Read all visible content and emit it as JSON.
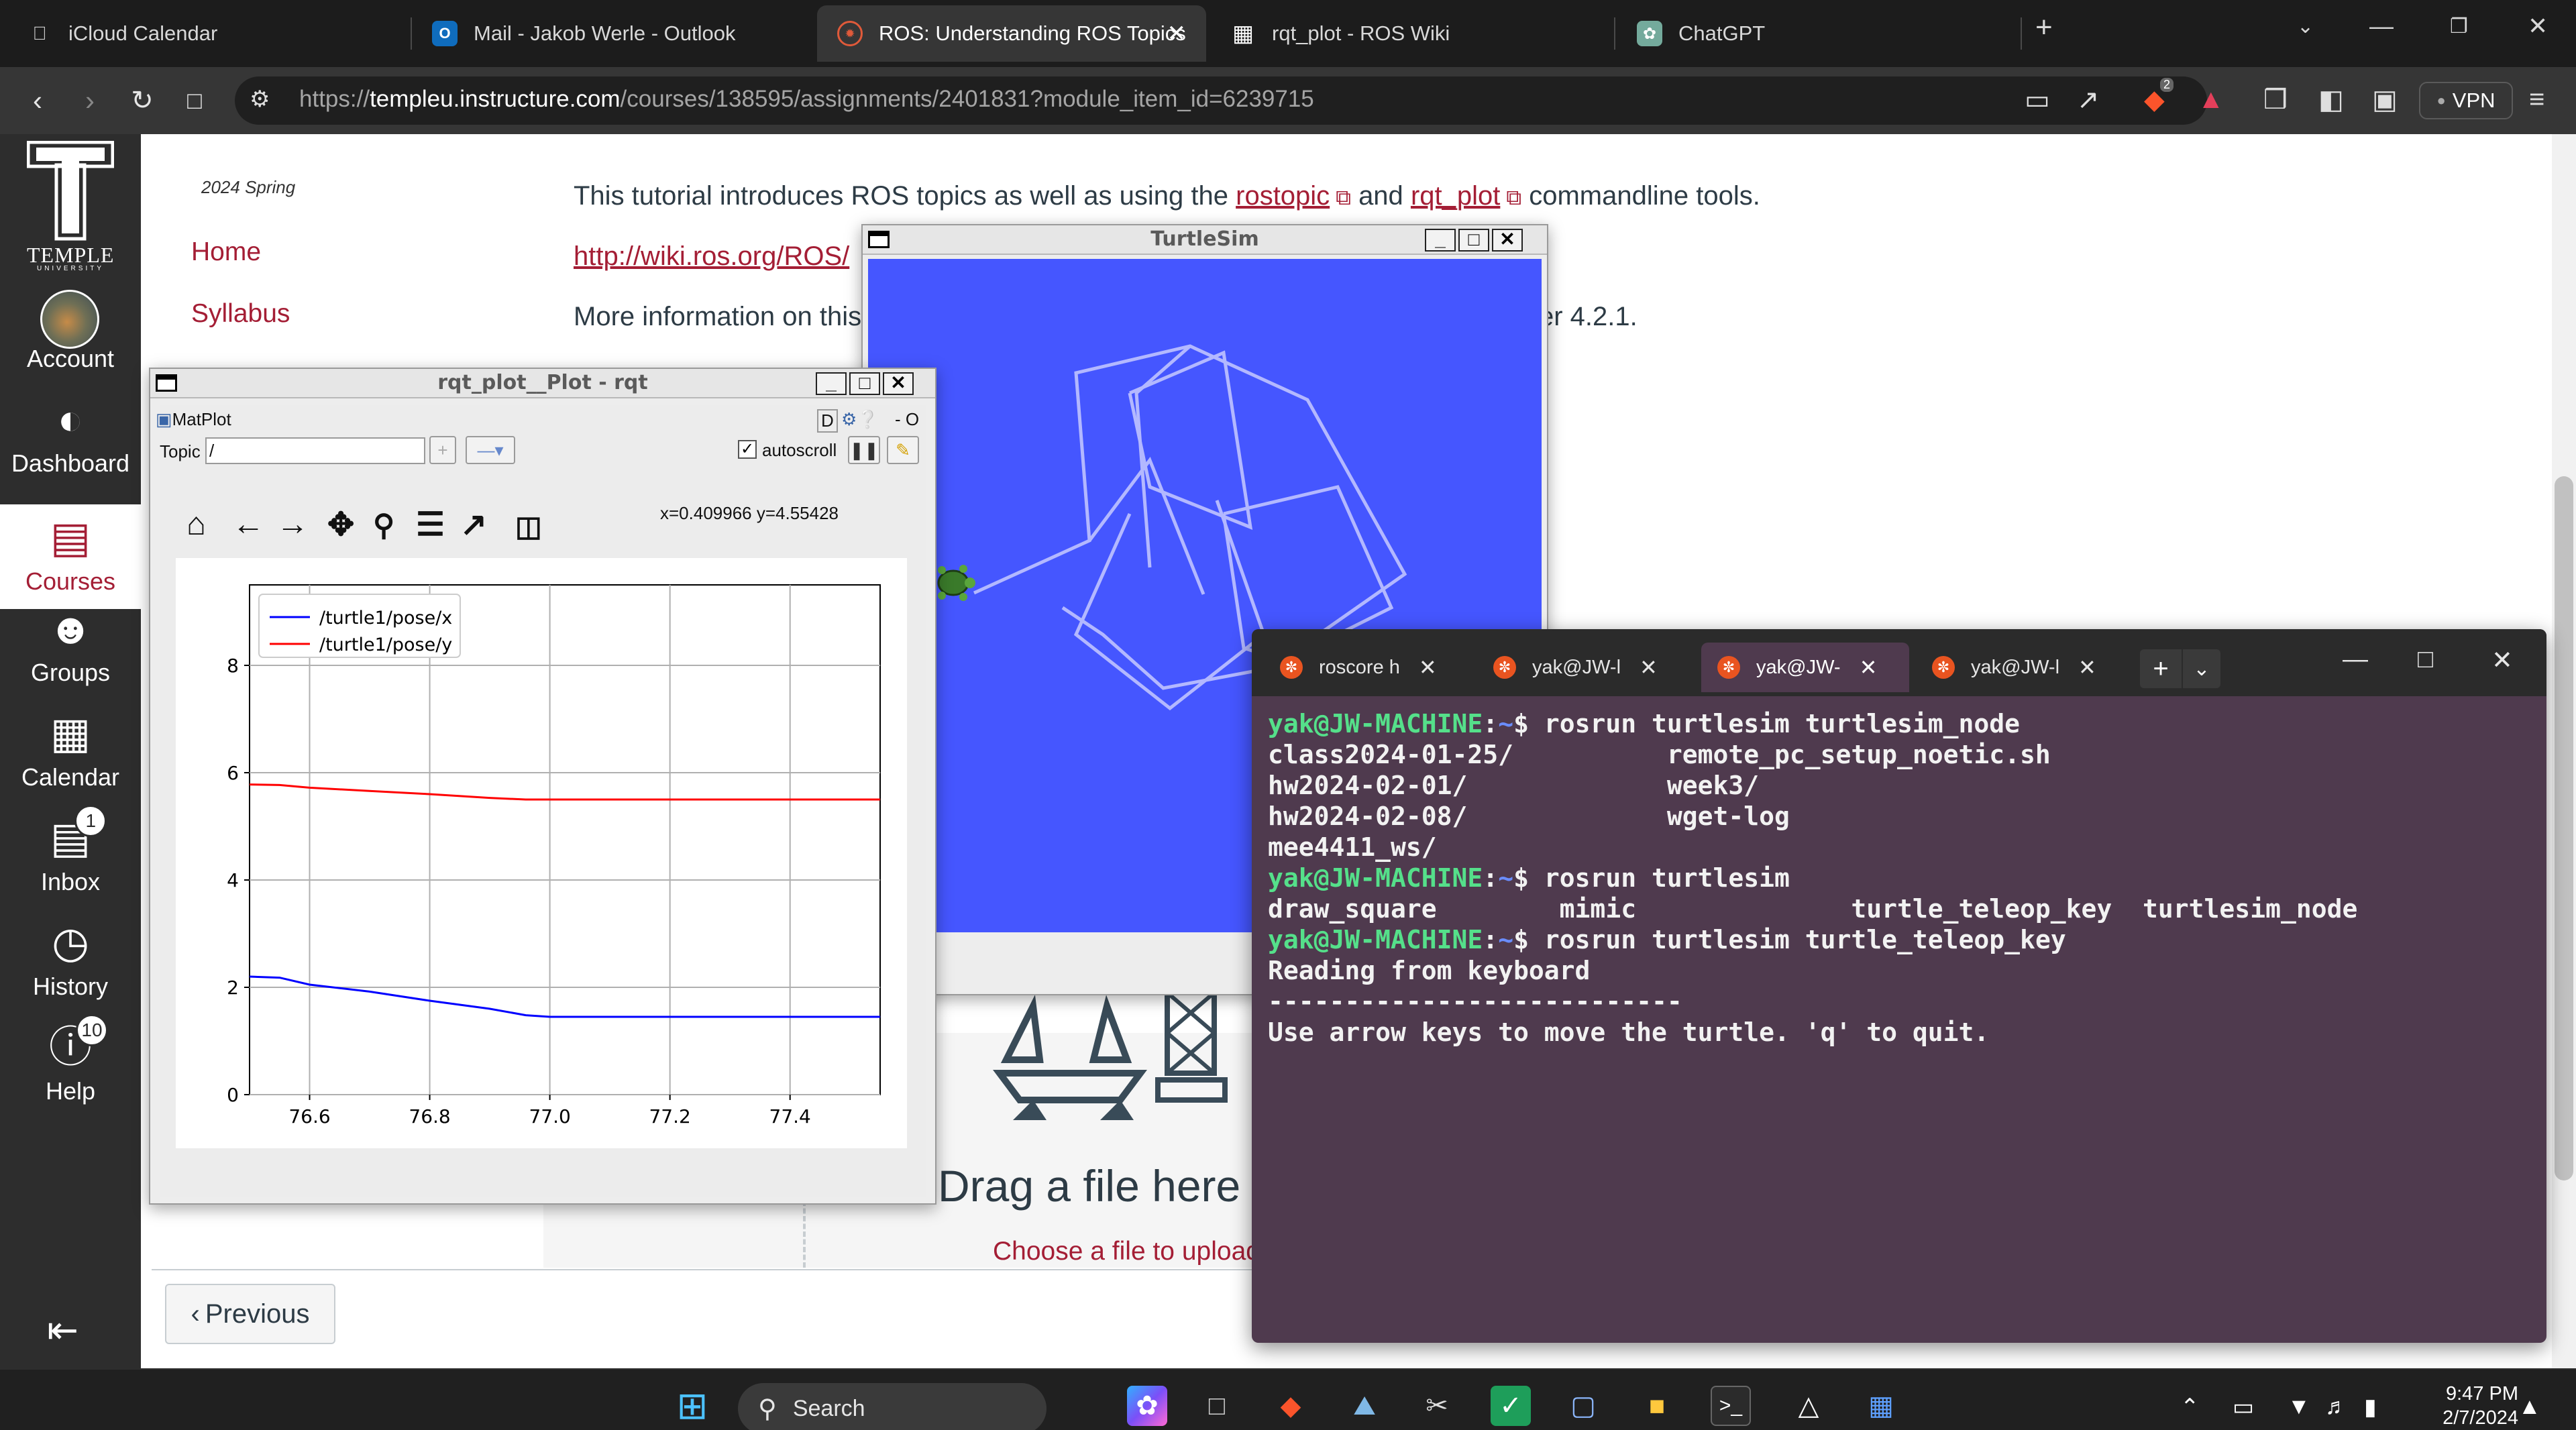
{
  "browser": {
    "tabs": [
      {
        "label": "iCloud Calendar",
        "icon": "apple-icon"
      },
      {
        "label": "Mail - Jakob Werle - Outlook",
        "icon": "outlook-icon"
      },
      {
        "label": "ROS: Understanding ROS Topics",
        "icon": "ros-icon",
        "active": true
      },
      {
        "label": "rqt_plot - ROS Wiki",
        "icon": "ros-wiki-icon"
      },
      {
        "label": "ChatGPT",
        "icon": "chatgpt-icon"
      }
    ],
    "url_prefix": "https://",
    "url_domain": "templeu.instructure.com",
    "url_path": "/courses/138595/assignments/2401831?module_item_id=6239715",
    "vpn_label": "VPN",
    "brave_badge": "2"
  },
  "sidebar": {
    "logo_text": "TEMPLE",
    "logo_sub": "UNIVERSITY",
    "items": [
      {
        "label": "Account",
        "icon": "avatar-icon"
      },
      {
        "label": "Dashboard",
        "icon": "dashboard-icon"
      },
      {
        "label": "Courses",
        "icon": "courses-icon",
        "active": true
      },
      {
        "label": "Groups",
        "icon": "groups-icon"
      },
      {
        "label": "Calendar",
        "icon": "calendar-icon"
      },
      {
        "label": "Inbox",
        "icon": "inbox-icon",
        "badge": "1"
      },
      {
        "label": "History",
        "icon": "history-icon"
      },
      {
        "label": "Help",
        "icon": "help-icon",
        "badge": "10"
      }
    ]
  },
  "course": {
    "term": "2024 Spring",
    "nav": [
      "Home",
      "Syllabus"
    ]
  },
  "content": {
    "line1_pre": "This tutorial introduces ROS topics as well as using the",
    "link_rostopic": "rostopic",
    "line1_and": "and",
    "link_rqt_plot": "rqt_plot",
    "line1_post": "commandline tools.",
    "link_wiki": "http://wiki.ros.org/ROS/",
    "line3_pre": "More information on this",
    "line3_post": "er 4.2.1.",
    "drag_text": "Drag a file here",
    "choose_text": "Choose a file to upload",
    "previous_label": "Previous"
  },
  "rqt": {
    "title": "rqt_plot__Plot - rqt",
    "plugin_label": "MatPlot",
    "plugin_controls": "D",
    "plugin_extra": "- O",
    "topic_label": "Topic",
    "topic_value": "/",
    "autoscroll_label": "autoscroll",
    "coords": "x=0.409966     y=4.55428"
  },
  "chart_data": {
    "type": "line",
    "title": "",
    "xlabel": "",
    "ylabel": "",
    "xlim": [
      76.5,
      77.55
    ],
    "ylim": [
      0,
      9.5
    ],
    "x_ticks": [
      76.6,
      76.8,
      77.0,
      77.2,
      77.4
    ],
    "x_tick_labels": [
      "76.6",
      "76.8",
      "77.0",
      "77.2",
      "77.4"
    ],
    "y_ticks": [
      0,
      2,
      4,
      6,
      8
    ],
    "y_tick_labels": [
      "0",
      "2",
      "4",
      "6",
      "8"
    ],
    "grid": true,
    "legend_position": "top-left",
    "series": [
      {
        "name": "/turtle1/pose/x",
        "color": "#0000ff",
        "x": [
          76.5,
          76.55,
          76.6,
          76.7,
          76.8,
          76.9,
          76.96,
          77.0,
          77.2,
          77.4,
          77.55
        ],
        "y": [
          2.2,
          2.18,
          2.05,
          1.92,
          1.75,
          1.6,
          1.48,
          1.45,
          1.45,
          1.45,
          1.45
        ]
      },
      {
        "name": "/turtle1/pose/y",
        "color": "#ff0000",
        "x": [
          76.5,
          76.55,
          76.6,
          76.7,
          76.8,
          76.9,
          76.96,
          77.0,
          77.2,
          77.4,
          77.55
        ],
        "y": [
          5.78,
          5.77,
          5.72,
          5.66,
          5.6,
          5.53,
          5.5,
          5.5,
          5.5,
          5.5,
          5.5
        ]
      }
    ]
  },
  "turtlesim": {
    "title": "TurtleSim",
    "bg_color": "#4556ff",
    "pen_color": "#b3b8ff"
  },
  "terminal": {
    "tabs": [
      {
        "label": "roscore h"
      },
      {
        "label": "yak@JW-l"
      },
      {
        "label": "yak@JW-",
        "active": true
      },
      {
        "label": "yak@JW-l"
      }
    ],
    "prompt_user": "yak@JW-MACHINE",
    "prompt_sep": ":",
    "prompt_path": "~",
    "prompt_end": "$ ",
    "lines": [
      {
        "prompt": true,
        "text": "rosrun turtlesim turtlesim_node"
      },
      {
        "prompt": false,
        "text": "class2024-01-25/          remote_pc_setup_noetic.sh"
      },
      {
        "prompt": false,
        "text": "hw2024-02-01/             week3/"
      },
      {
        "prompt": false,
        "text": "hw2024-02-08/             wget-log"
      },
      {
        "prompt": false,
        "text": "mee4411_ws/"
      },
      {
        "prompt": true,
        "text": "rosrun turtlesim"
      },
      {
        "prompt": false,
        "text": "draw_square        mimic              turtle_teleop_key  turtlesim_node"
      },
      {
        "prompt": true,
        "text": "rosrun turtlesim turtle_teleop_key"
      },
      {
        "prompt": false,
        "text": "Reading from keyboard"
      },
      {
        "prompt": false,
        "text": "---------------------------"
      },
      {
        "prompt": false,
        "text": "Use arrow keys to move the turtle. 'q' to quit."
      }
    ]
  },
  "taskbar": {
    "search_label": "Search",
    "time": "9:47 PM",
    "date": "2/7/2024"
  }
}
